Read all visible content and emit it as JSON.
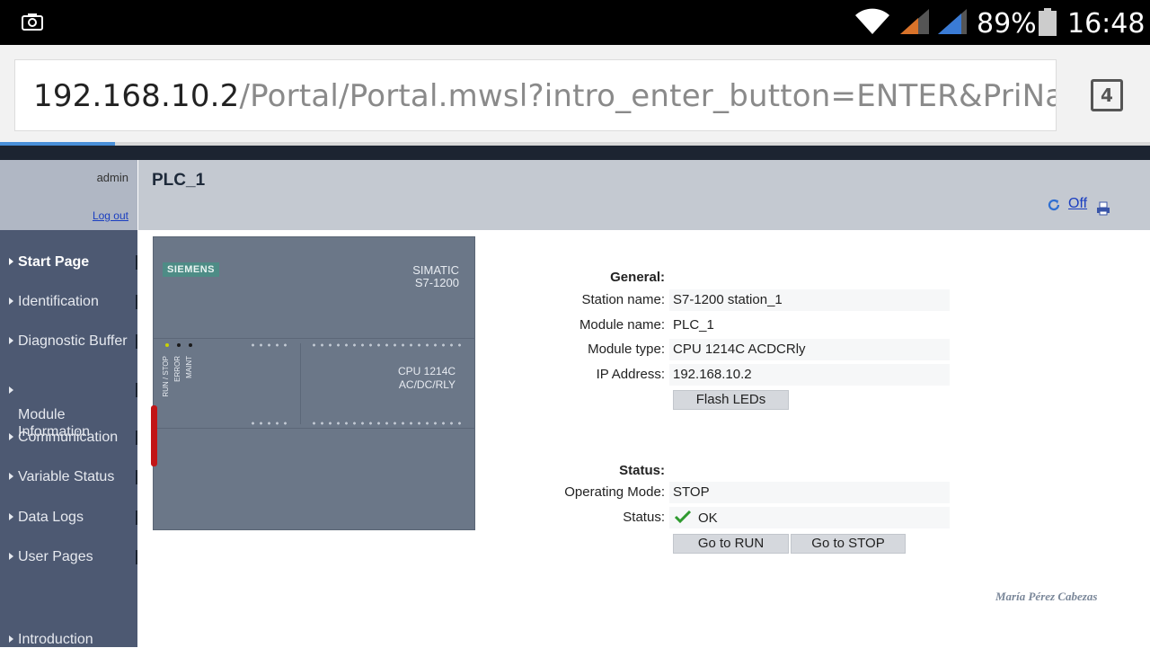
{
  "statusbar": {
    "camera_icon": "camera-icon",
    "battery_percent": "89%",
    "time": "16:48",
    "colors": {
      "signal_orange": "#d9732a",
      "signal_blue": "#3a7bd5"
    }
  },
  "browser": {
    "url_host": "192.168.10.2",
    "url_path": "/Portal/Portal.mwsl?intro_enter_button=ENTER&PriNa",
    "tab_count": "4",
    "load_progress_percent": 10
  },
  "user": {
    "name": "admin",
    "logout_label": "Log out"
  },
  "nav": {
    "items": [
      {
        "label": "Start Page",
        "active": true
      },
      {
        "label": "Identification"
      },
      {
        "label": "Diagnostic Buffer"
      },
      {
        "label": "Module\nInformation"
      },
      {
        "label": "Communication"
      },
      {
        "label": "Variable Status"
      },
      {
        "label": "Data Logs"
      },
      {
        "label": "User Pages"
      },
      {
        "label": "Introduction"
      }
    ]
  },
  "header": {
    "title": "PLC_1",
    "refresh_label": "Off"
  },
  "device_image": {
    "brand": "SIEMENS",
    "model_line1": "SIMATIC",
    "model_line2": "S7-1200",
    "led_run": "RUN / STOP",
    "led_error": "ERROR",
    "led_maint": "MAINT",
    "cpu_line1": "CPU 1214C",
    "cpu_line2": "AC/DC/RLY"
  },
  "general": {
    "heading": "General:",
    "station_name_label": "Station name:",
    "station_name": "S7-1200 station_1",
    "module_name_label": "Module name:",
    "module_name": "PLC_1",
    "module_type_label": "Module type:",
    "module_type": "CPU 1214C ACDCRly",
    "ip_label": "IP Address:",
    "ip": "192.168.10.2",
    "flash_leds_button": "Flash LEDs"
  },
  "status": {
    "heading": "Status:",
    "operating_mode_label": "Operating Mode:",
    "operating_mode": "STOP",
    "status_label": "Status:",
    "status_value": "OK",
    "go_run_button": "Go to RUN",
    "go_stop_button": "Go to STOP"
  },
  "watermark": "María Pérez Cabezas"
}
